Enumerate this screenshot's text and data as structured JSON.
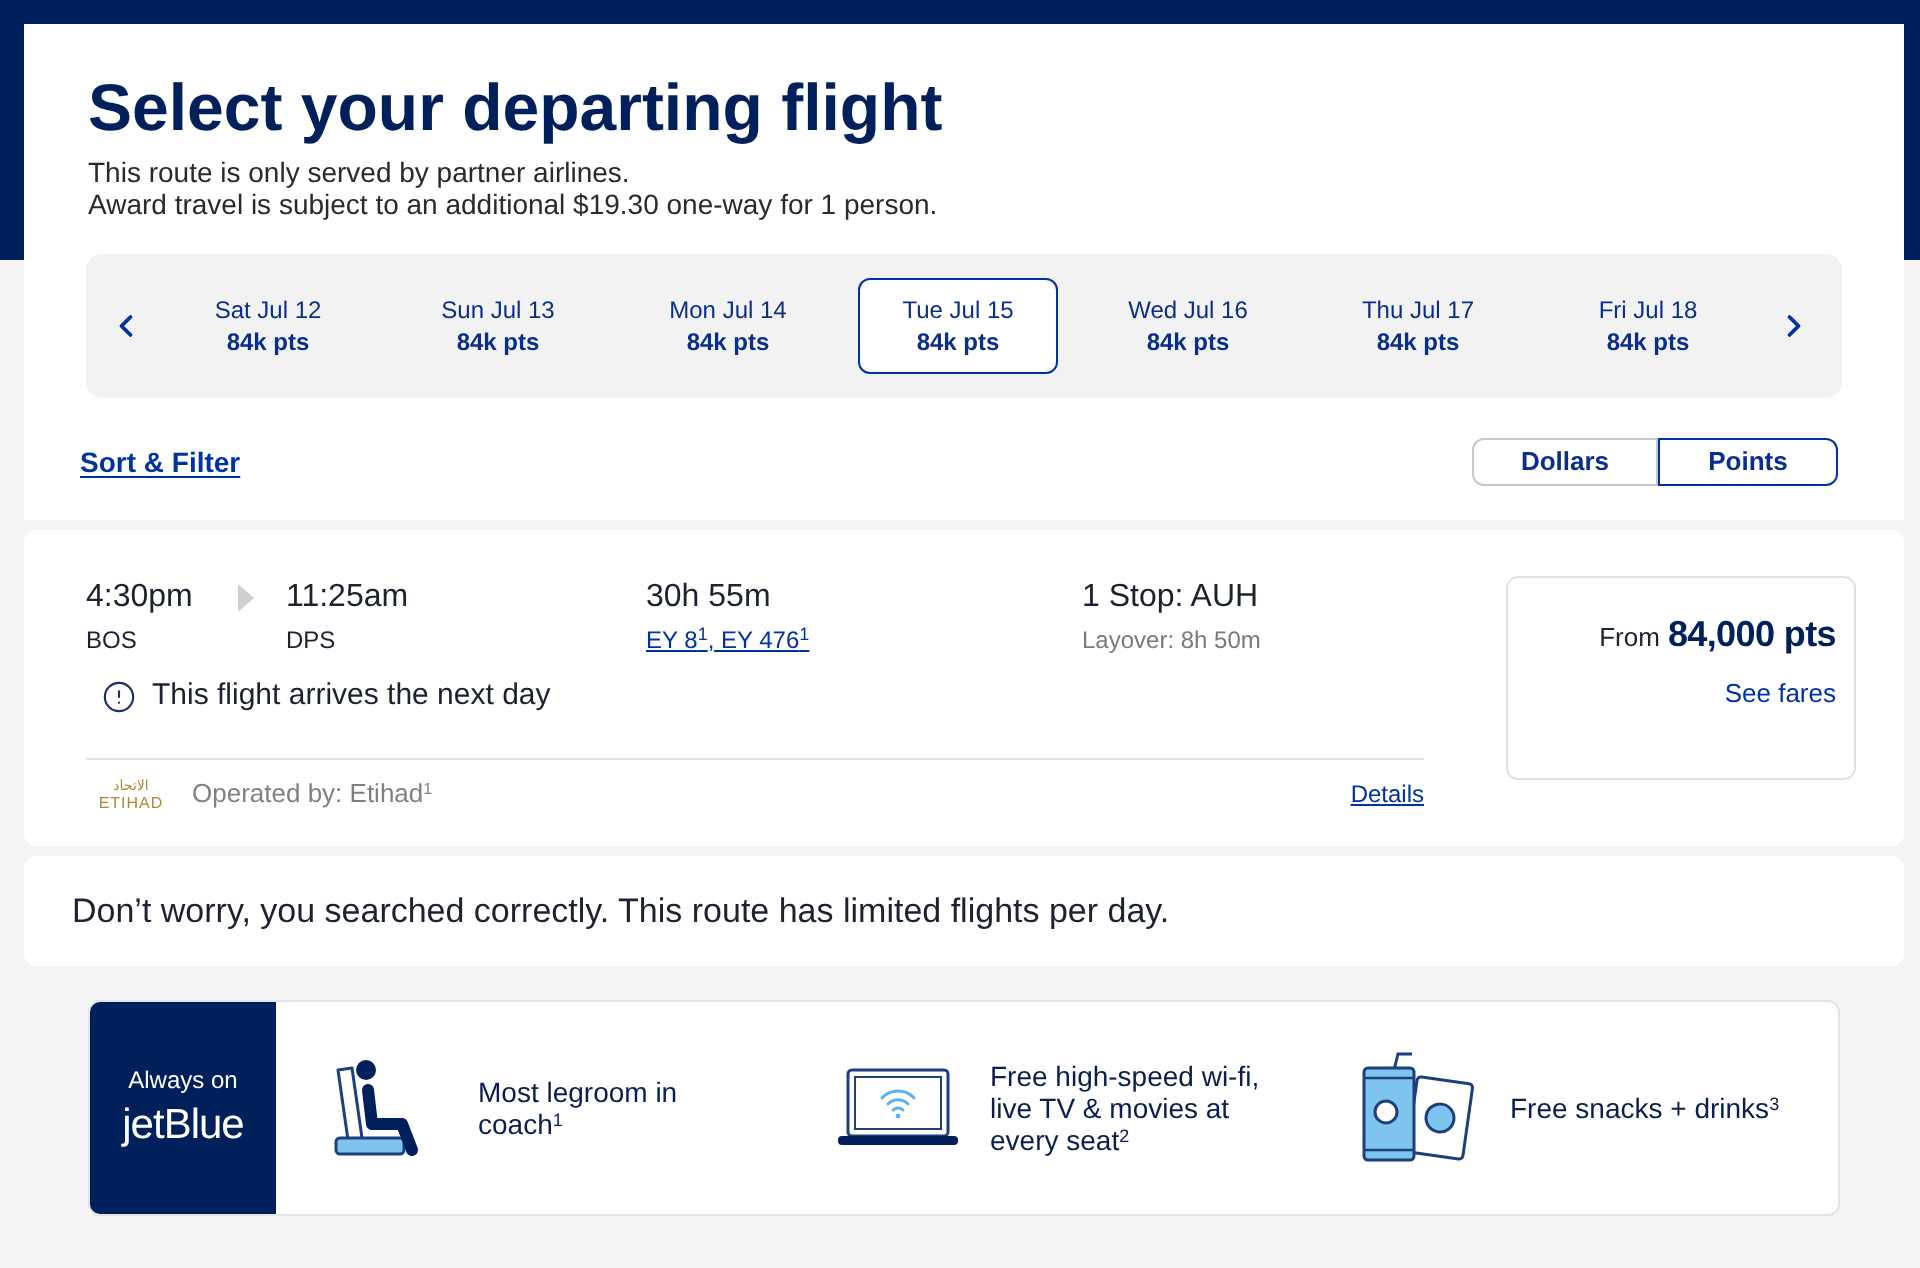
{
  "header": {
    "title": "Select your departing flight",
    "notes": [
      "This route is only served by partner airlines.",
      "Award travel is subject to an additional $19.30 one-way for 1 person."
    ]
  },
  "date_strip": {
    "dates": [
      {
        "day": "Sat Jul 12",
        "price": "84k pts",
        "selected": false
      },
      {
        "day": "Sun Jul 13",
        "price": "84k pts",
        "selected": false
      },
      {
        "day": "Mon Jul 14",
        "price": "84k pts",
        "selected": false
      },
      {
        "day": "Tue Jul 15",
        "price": "84k pts",
        "selected": true
      },
      {
        "day": "Wed Jul 16",
        "price": "84k pts",
        "selected": false
      },
      {
        "day": "Thu Jul 17",
        "price": "84k pts",
        "selected": false
      },
      {
        "day": "Fri Jul 18",
        "price": "84k pts",
        "selected": false
      }
    ]
  },
  "sort_filter_link": "Sort & Filter",
  "currency_toggle": [
    {
      "label": "Dollars",
      "selected": false
    },
    {
      "label": "Points",
      "selected": true
    }
  ],
  "flight": {
    "departure": {
      "time": "4:30pm",
      "airport": "BOS"
    },
    "arrival": {
      "time": "11:25am",
      "airport": "DPS"
    },
    "duration": "30h 55m",
    "flight_numbers": "EY 8$^{1}$, EY 476$^{1}$",
    "stops": "1 Stop: AUH",
    "layover": "Layover: 8h 50m",
    "notice": "This flight arrives the next day",
    "airline_logo": {
      "arabic": "الاتحاد",
      "name": "ETIHAD"
    },
    "operator": "Operated by: Etihad$^{1}$",
    "details_link": "Details",
    "price": {
      "prefix": "From",
      "amount": "84,000 pts",
      "see_fares": "See fares"
    }
  },
  "message": "Don’t worry, you searched correctly. This route has limited flights per day.",
  "amenities": {
    "brand": {
      "tagline": "Always on",
      "name": "jetBlue"
    },
    "items": [
      {
        "kind": "seat",
        "text": "Most legroom in coach$^{1}$"
      },
      {
        "kind": "wifi",
        "text": "Free high-speed wi-fi, live TV & movies at every seat$^{2}$"
      },
      {
        "kind": "snacks",
        "text": "Free snacks + drinks$^{3}$"
      }
    ]
  }
}
